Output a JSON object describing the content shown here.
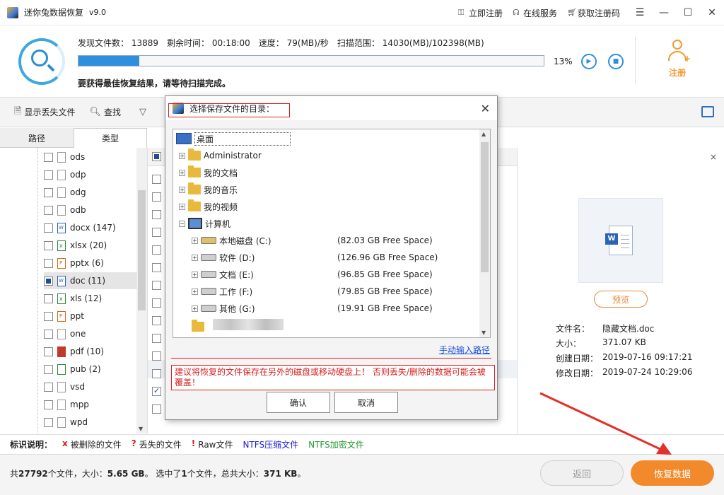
{
  "window": {
    "title": "迷你兔数据恢复",
    "version": "v9.0",
    "links": [
      {
        "icon": "key-icon",
        "label": "立即注册"
      },
      {
        "icon": "headset-icon",
        "label": "在线服务"
      },
      {
        "icon": "cart-icon",
        "label": "获取注册码"
      }
    ],
    "controls": {
      "menu": "☰",
      "minimize": "—",
      "maximize": "☐",
      "close": "✕"
    }
  },
  "scan": {
    "found_label": "发现文件数：",
    "found_value": "13889",
    "remaining_label": "剩余时间：",
    "remaining_value": "00:18:00",
    "speed_label": "速度：",
    "speed_value": "79(MB)/秒",
    "range_label": "扫描范围：",
    "range_value": "14030(MB)/102398(MB)",
    "progress_percent": 13,
    "progress_text": "13%",
    "hint": "要获得最佳恢复结果，请等待扫描完成。",
    "play_glyph": "▶",
    "stop_glyph": "■"
  },
  "register": {
    "label": "注册",
    "plus": "+"
  },
  "toolbar": {
    "show_lost": "显示丢失文件",
    "find": "查找"
  },
  "tabs": [
    {
      "label": "路径"
    },
    {
      "label": "类型"
    }
  ],
  "tree_items": [
    {
      "label": "ods",
      "icon": "file-icon",
      "kind": ""
    },
    {
      "label": "odp",
      "icon": "file-icon",
      "kind": ""
    },
    {
      "label": "odg",
      "icon": "file-icon",
      "kind": ""
    },
    {
      "label": "odb",
      "icon": "file-icon",
      "kind": ""
    },
    {
      "label": "docx (147)",
      "icon": "word-file-icon",
      "kind": "word"
    },
    {
      "label": "xlsx (20)",
      "icon": "excel-file-icon",
      "kind": "excel"
    },
    {
      "label": "pptx (6)",
      "icon": "ppt-file-icon",
      "kind": "ppt"
    },
    {
      "label": "doc (11)",
      "icon": "word-file-icon",
      "kind": "word",
      "selected": true
    },
    {
      "label": "xls (12)",
      "icon": "excel-file-icon",
      "kind": "excel"
    },
    {
      "label": "ppt",
      "icon": "ppt-file-icon",
      "kind": "ppt"
    },
    {
      "label": "one",
      "icon": "file-icon",
      "kind": ""
    },
    {
      "label": "pdf (10)",
      "icon": "pdf-file-icon",
      "kind": "pdf"
    },
    {
      "label": "pub (2)",
      "icon": "pub-file-icon",
      "kind": "pub"
    },
    {
      "label": "vsd",
      "icon": "file-icon",
      "kind": ""
    },
    {
      "label": "mpp",
      "icon": "file-icon",
      "kind": ""
    },
    {
      "label": "wpd",
      "icon": "file-icon",
      "kind": ""
    }
  ],
  "preview": {
    "close": "×",
    "button": "预览",
    "file_name_label": "文件名：",
    "file_name": "隐藏文档.doc",
    "size_label": "大小：",
    "size": "371.07 KB",
    "created_label": "创建日期：",
    "created": "2019-07-16 09:17:21",
    "modified_label": "修改日期：",
    "modified": "2019-07-24 10:29:06"
  },
  "legend": {
    "title": "标识说明：",
    "deleted_mark": "x",
    "deleted": "被删除的文件",
    "lost_mark": "?",
    "lost": "丢失的文件",
    "raw_mark": "!",
    "raw": "Raw文件",
    "ntfs_compressed": "NTFS压缩文件",
    "ntfs_encrypted": "NTFS加密文件",
    "colors": {
      "compressed": "#1a1adb",
      "encrypted": "#1e9a2e",
      "mark": "#d41c1c"
    }
  },
  "status": {
    "p1": "共",
    "total_files": "27792",
    "p2": "个文件，大小：",
    "total_size": "5.65 GB",
    "p3": "。 选中了",
    "selected_count": "1",
    "p4": "个文件，总共大小：",
    "selected_size": "371 KB",
    "p5": "。"
  },
  "buttons": {
    "back": "返回",
    "recover": "恢复数据"
  },
  "dialog": {
    "title": "选择保存文件的目录：",
    "close": "✕",
    "root": "桌面",
    "nodes": [
      {
        "label": "Administrator",
        "type": "user"
      },
      {
        "label": "我的文档",
        "type": "folder"
      },
      {
        "label": "我的音乐",
        "type": "folder"
      },
      {
        "label": "我的视频",
        "type": "folder"
      },
      {
        "label": "计算机",
        "type": "pc"
      }
    ],
    "drives": [
      {
        "label": "本地磁盘 (C:)",
        "free": "(82.03 GB Free Space)",
        "sys": true
      },
      {
        "label": "软件 (D:)",
        "free": "(126.96 GB Free Space)"
      },
      {
        "label": "文档 (E:)",
        "free": "(96.85 GB Free Space)"
      },
      {
        "label": "工作 (F:)",
        "free": "(79.85 GB Free Space)"
      },
      {
        "label": "其他 (G:)",
        "free": "(19.91 GB Free Space)"
      }
    ],
    "manual_link": "手动输入路径",
    "warning": "建议将恢复的文件保存在另外的磁盘或移动硬盘上！ 否则丢失/删除的数据可能会被覆盖！",
    "ok": "确认",
    "cancel": "取消"
  }
}
